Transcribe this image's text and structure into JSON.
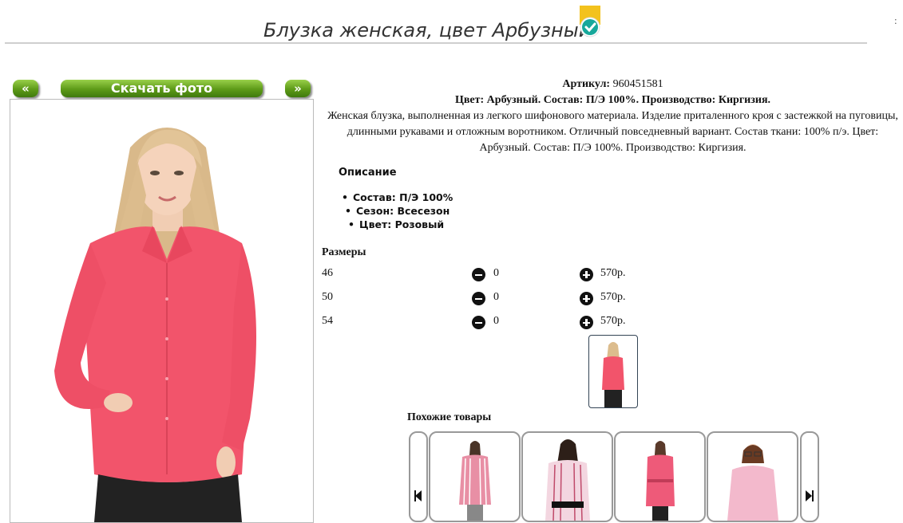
{
  "header": {
    "title": "Блузка женская, цвет Арбузный",
    "stray_char": ":"
  },
  "gallery": {
    "prev_label": "«",
    "download_label": "Скачать фото",
    "next_label": "»"
  },
  "product": {
    "article_label": "Артикул:",
    "article_value": "960451581",
    "summary": "Цвет: Арбузный. Состав: П/Э 100%. Производство: Киргизия.",
    "description": "Женская блузка, выполненная из легкого шифонового материала. Изделие приталенного кроя с застежкой на пуговицы, длинными рукавами и отложным воротником. Отличный повседневный вариант. Состав ткани: 100% п/э. Цвет: Арбузный. Состав: П/Э 100%. Производство: Киргизия.",
    "features_heading": "Описание",
    "features": [
      "Состав: П/Э 100%",
      "Сезон: Всесезон",
      "Цвет: Розовый"
    ]
  },
  "sizes": {
    "heading": "Размеры",
    "rows": [
      {
        "size": "46",
        "qty": "0",
        "price": "570р."
      },
      {
        "size": "50",
        "qty": "0",
        "price": "570р."
      },
      {
        "size": "54",
        "qty": "0",
        "price": "570р."
      }
    ]
  },
  "similar": {
    "heading": "Похожие товары"
  },
  "colors": {
    "accent_green": "#5d9a18",
    "blouse_pink": "#f2546b",
    "badge_yellow": "#f3c21d",
    "badge_teal": "#17a89b"
  }
}
